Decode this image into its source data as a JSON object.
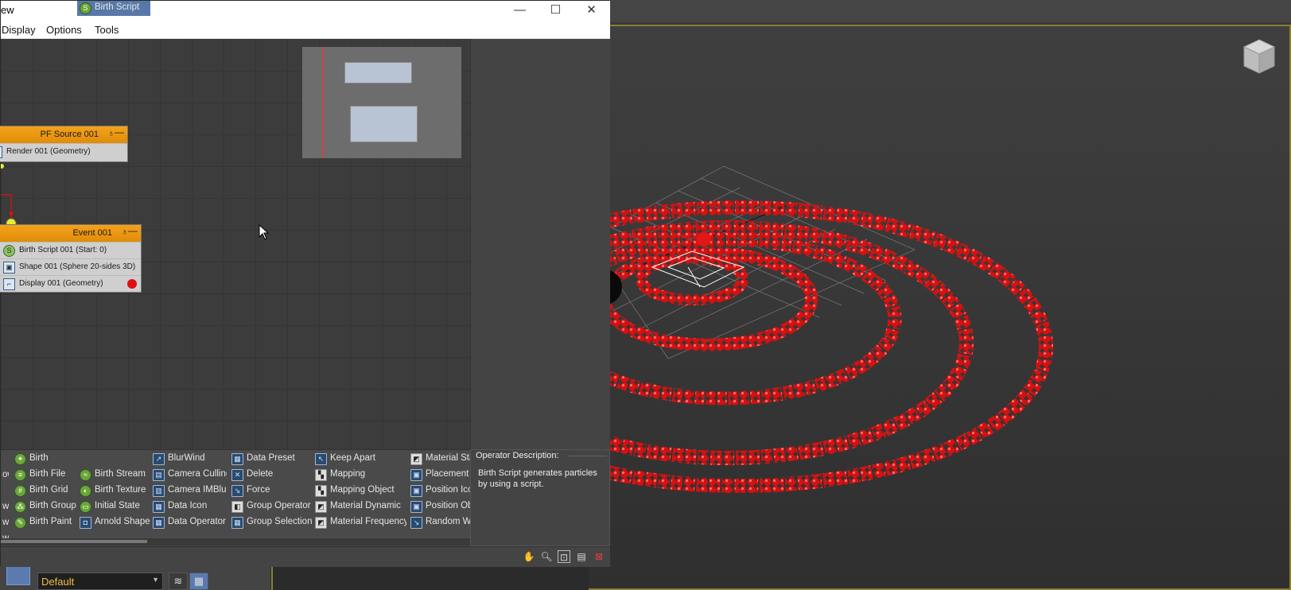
{
  "window": {
    "title_fragment": "ew",
    "minimize": "—",
    "maximize": "☐",
    "close": "✕"
  },
  "menu": [
    "Display",
    "Options",
    "Tools"
  ],
  "nodes": {
    "source": {
      "title": "PF Source 001",
      "rows": [
        "Render 001 (Geometry)"
      ]
    },
    "event": {
      "title": "Event 001",
      "rows": [
        "Birth Script 001 (Start: 0)",
        "Shape 001 (Sphere 20-sides 3D)",
        "Display 001 (Geometry)"
      ]
    }
  },
  "depot": {
    "col0": [
      "ow",
      "w",
      "w",
      "w"
    ],
    "col1": [
      "Birth",
      "Birth File",
      "Birth Grid",
      "Birth Group",
      "Birth Paint"
    ],
    "col2": [
      "Birth Script",
      "Birth Stream",
      "Birth Texture",
      "Initial State",
      "Arnold Shape"
    ],
    "col3": [
      "BlurWind",
      "Camera Culling",
      "Camera IMBlur",
      "Data Icon",
      "Data Operator"
    ],
    "col4": [
      "Data Preset",
      "Delete",
      "Force",
      "Group Operator",
      "Group Selection"
    ],
    "col5": [
      "Keep Apart",
      "Mapping",
      "Mapping Object",
      "Material Dynamic",
      "Material Frequency"
    ],
    "col6": [
      "Material Sta",
      "Placement F",
      "Position Ico",
      "Position Obj",
      "Random Wa"
    ],
    "selected": "Birth Script"
  },
  "description": {
    "title": "Operator Description:",
    "text": "Birth Script generates particles by using a script."
  },
  "layer_dropdown": {
    "value": "Default"
  },
  "colors": {
    "accent_orange": "#f4a21a",
    "selection_blue": "#5778a8",
    "particle_red": "#e01010"
  },
  "icons": [
    "hand-pan-icon",
    "zoom-icon",
    "zoom-region-icon",
    "zoom-extents-icon",
    "no-zoom-icon"
  ]
}
